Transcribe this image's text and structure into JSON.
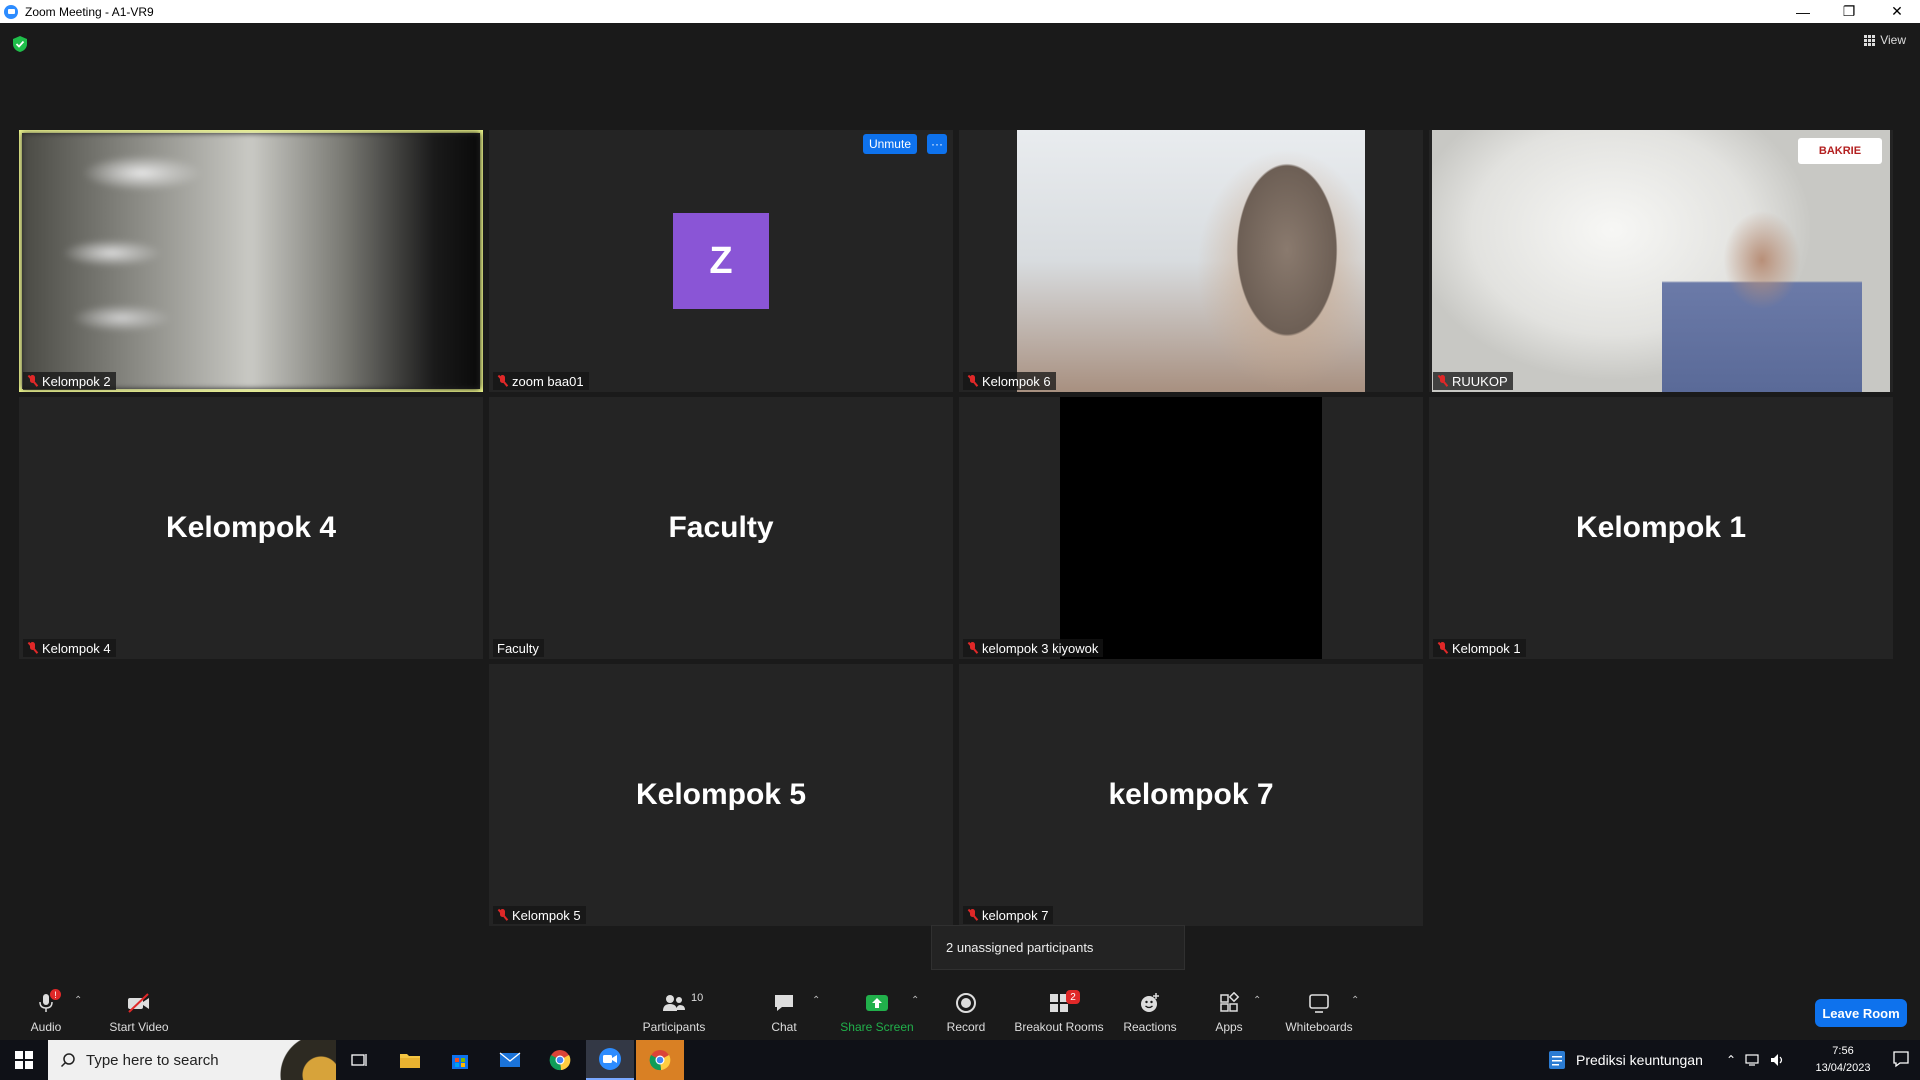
{
  "window": {
    "title": "Zoom Meeting - A1-VR9"
  },
  "view_button": {
    "label": "View"
  },
  "tiles": [
    {
      "name": "Kelompok 2",
      "big": "",
      "muted": true
    },
    {
      "name": "zoom baa01",
      "big": "",
      "muted": true,
      "avatar_letter": "Z",
      "unmute_label": "Unmute",
      "more_label": "···"
    },
    {
      "name": "Kelompok 6",
      "big": "",
      "muted": true
    },
    {
      "name": "RUUKOP",
      "big": "",
      "muted": true,
      "logo_text": "BAKRIE"
    },
    {
      "name": "Kelompok 4",
      "big": "Kelompok 4",
      "muted": true
    },
    {
      "name": "Faculty",
      "big": "Faculty",
      "muted": false
    },
    {
      "name": "kelompok 3 kiyowok",
      "big": "",
      "muted": true
    },
    {
      "name": "Kelompok 1",
      "big": "Kelompok 1",
      "muted": true
    },
    {
      "name": "Kelompok 5",
      "big": "Kelompok 5",
      "muted": true
    },
    {
      "name": "kelompok 7",
      "big": "kelompok 7",
      "muted": true
    }
  ],
  "tooltip": {
    "text": "2 unassigned participants"
  },
  "toolbar": {
    "audio": "Audio",
    "audio_badge": "!",
    "start_video": "Start Video",
    "participants": "Participants",
    "participants_count": "10",
    "chat": "Chat",
    "share_screen": "Share Screen",
    "record": "Record",
    "breakout_rooms": "Breakout Rooms",
    "breakout_badge": "2",
    "reactions": "Reactions",
    "apps": "Apps",
    "whiteboards": "Whiteboards",
    "leave_room": "Leave Room"
  },
  "taskbar": {
    "search_placeholder": "Type here to search",
    "notification_text": "Prediksi keuntungan",
    "time": "7:56",
    "date": "13/04/2023"
  },
  "colors": {
    "active_speaker_border": "#ecf58a",
    "accent_blue": "#0e72ed",
    "share_green": "#21b04b",
    "muted_red": "#e02828",
    "avatar_purple": "#8a55d6"
  }
}
